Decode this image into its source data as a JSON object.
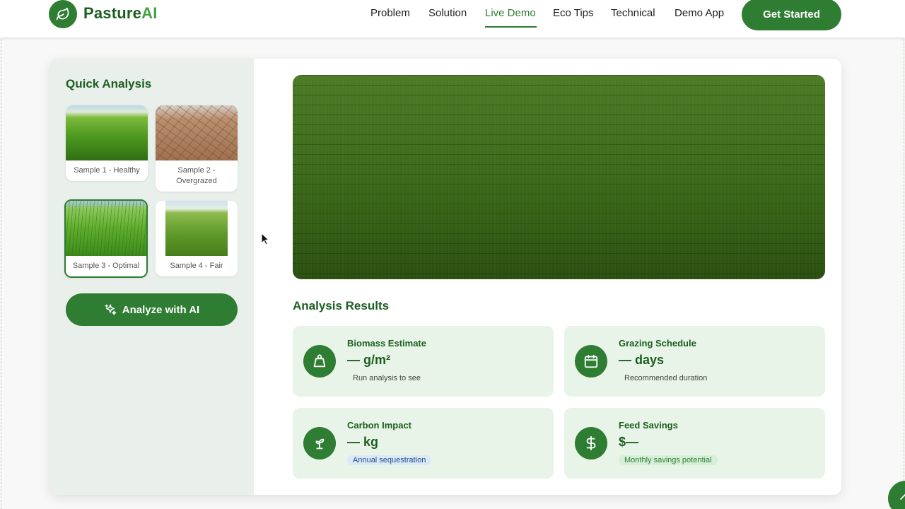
{
  "brand": {
    "name_main": "Pasture",
    "name_accent": "AI",
    "logo_icon": "leaf-icon"
  },
  "nav": {
    "links": [
      "Problem",
      "Solution",
      "Live Demo",
      "Eco Tips",
      "Technical",
      "Demo App"
    ],
    "active": "Live Demo",
    "cta_label": "Get Started"
  },
  "quick_analysis": {
    "title": "Quick Analysis",
    "samples": [
      {
        "label": "Sample 1 - Healthy",
        "selected": false
      },
      {
        "label": "Sample 2 - Overgrazed",
        "selected": false
      },
      {
        "label": "Sample 3 - Optimal",
        "selected": true
      },
      {
        "label": "Sample 4 - Fair",
        "selected": false
      }
    ],
    "analyze_label": "Analyze with AI",
    "analyze_icon": "sparkles-icon"
  },
  "results": {
    "title": "Analysis Results",
    "cards": [
      {
        "title": "Biomass Estimate",
        "value": "— g/m²",
        "note": "Run analysis to see",
        "icon": "weight-icon"
      },
      {
        "title": "Grazing Schedule",
        "value": "— days",
        "note": "Recommended duration",
        "icon": "calendar-icon"
      },
      {
        "title": "Carbon Impact",
        "value": "— kg",
        "note": "Annual sequestration",
        "icon": "sprout-icon"
      },
      {
        "title": "Feed Savings",
        "value": "$—",
        "note": "Monthly savings potential",
        "icon": "dollar-icon"
      }
    ]
  },
  "colors": {
    "primary": "#2e7d32",
    "primary_dark": "#1b5e20",
    "card_bg": "#e8f4e8",
    "panel_bg": "#e9efea"
  }
}
